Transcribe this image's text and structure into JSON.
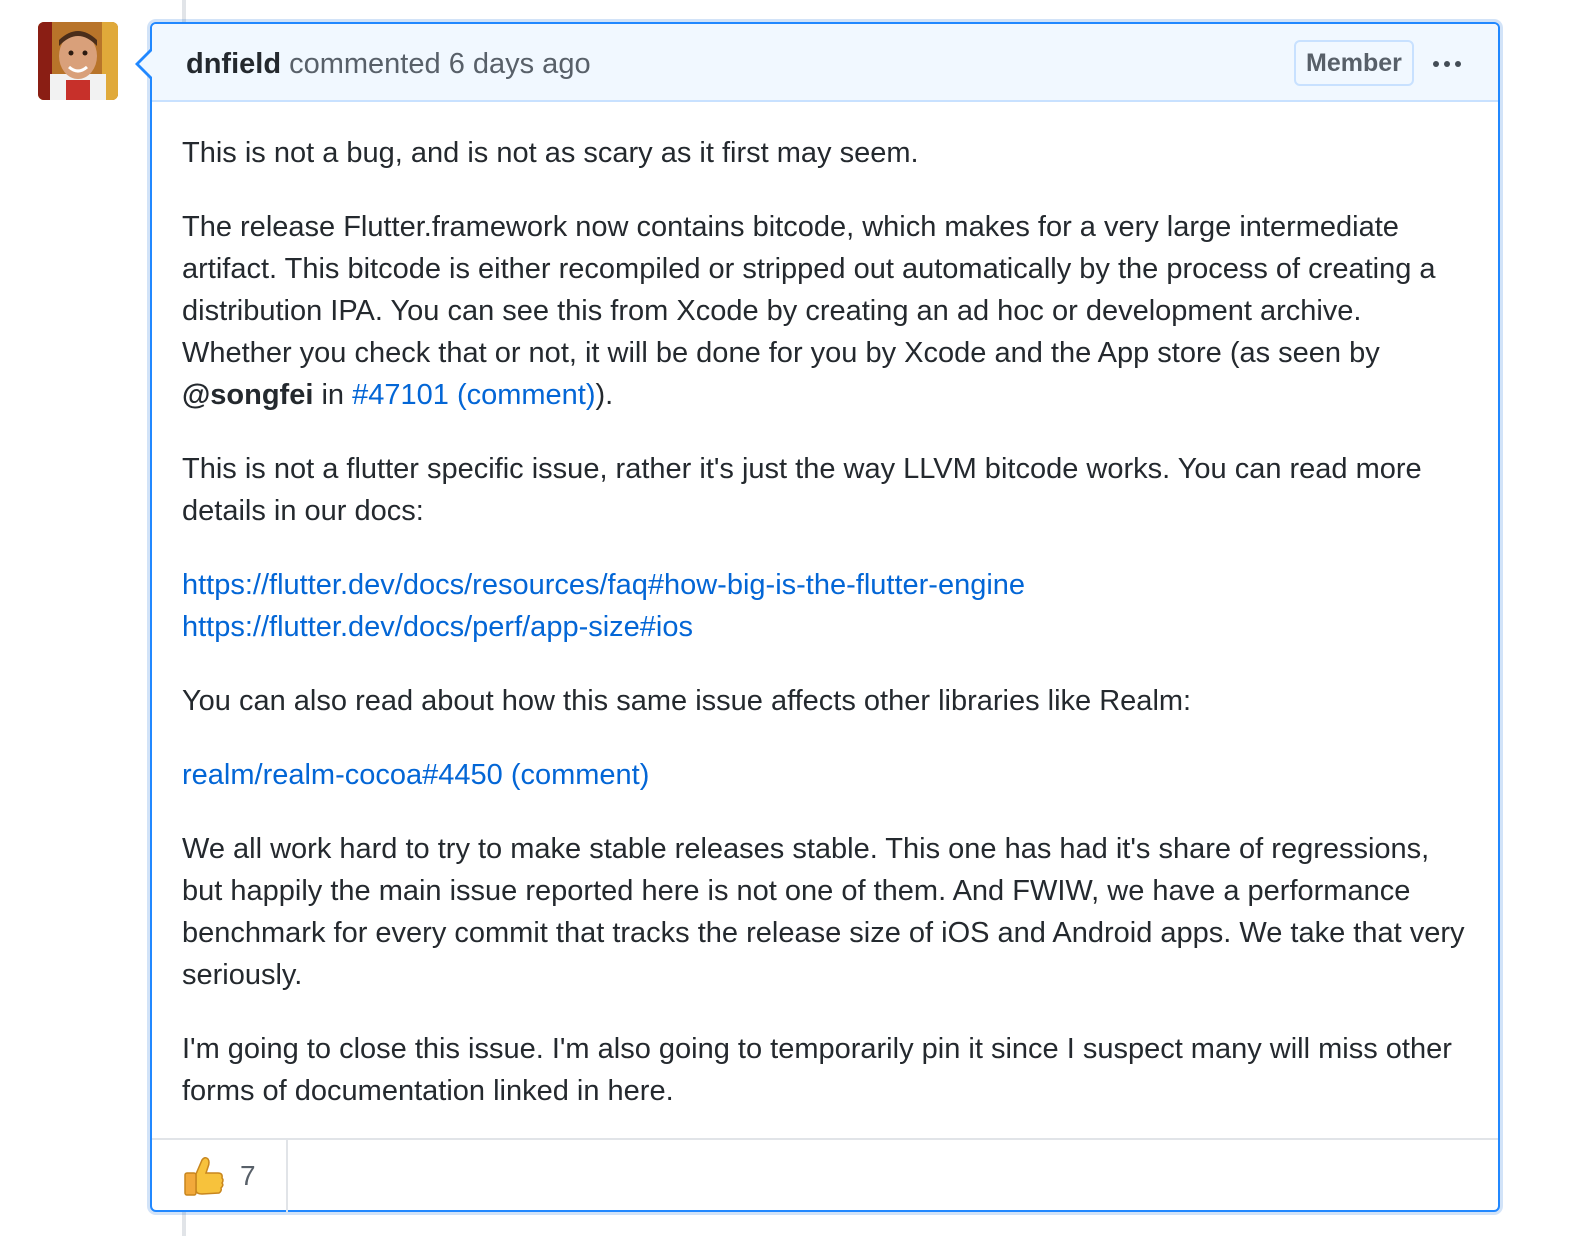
{
  "comment": {
    "author": "dnfield",
    "action": "commented",
    "timestamp": "6 days ago",
    "badge": "Member",
    "menu_icon": "kebab-horizontal-icon",
    "avatar_icon": "user-avatar-photo",
    "body": {
      "p1": "This is not a bug, and is not as scary as it first may seem.",
      "p2_text": "The release Flutter.framework now contains bitcode, which makes for a very large intermediate artifact. This bitcode is either recompiled or stripped out automatically by the process of creating a distribution IPA. You can see this from Xcode by creating an ad hoc or development archive. Whether you check that or not, it will be done for you by Xcode and the App store (as seen by ",
      "p2_mention": "@songfei",
      "p2_in": " in ",
      "p2_issue": "#47101",
      "p2_comment": "(comment)",
      "p2_end": ").",
      "p3": "This is not a flutter specific issue, rather it's just the way LLVM bitcode works. You can read more details in our docs:",
      "link1": "https://flutter.dev/docs/resources/faq#how-big-is-the-flutter-engine",
      "link2": "https://flutter.dev/docs/perf/app-size#ios",
      "p4": "You can also read about how this same issue affects other libraries like Realm:",
      "realm_link": "realm/realm-cocoa#4450 (comment)",
      "p5": "We all work hard to try to make stable releases stable. This one has had it's share of regressions, but happily the main issue reported here is not one of them. And FWIW, we have a performance benchmark for every commit that tracks the release size of iOS and Android apps. We take that very seriously.",
      "p6": "I'm going to close this issue. I'm also going to temporarily pin it since I suspect many will miss other forms of documentation linked in here."
    },
    "reactions": [
      {
        "icon": "thumbs-up-icon",
        "emoji": "👍",
        "count": "7"
      }
    ]
  },
  "colors": {
    "accent_border": "#2188ff",
    "header_bg": "#f1f8ff",
    "link": "#0366d6",
    "text": "#24292e",
    "muted": "#586069"
  }
}
